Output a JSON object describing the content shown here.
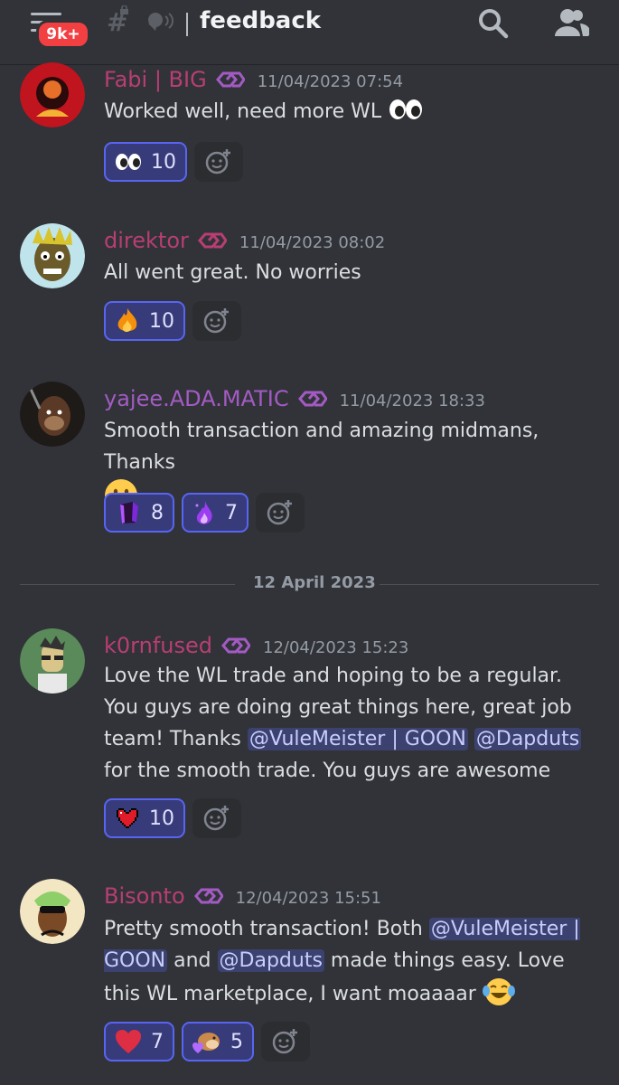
{
  "header": {
    "badge": "9k+",
    "channel_name": "feedback"
  },
  "messages": [
    {
      "username": "Fabi | BIG",
      "timestamp": "11/04/2023 07:54",
      "text": "Worked well, need more WL",
      "reactions": [
        {
          "emoji": "eyes",
          "count": "10"
        }
      ]
    },
    {
      "username": "direktor",
      "timestamp": "11/04/2023 08:02",
      "text": "All went great. No worries",
      "reactions": [
        {
          "emoji": "fire",
          "count": "10"
        }
      ]
    },
    {
      "username": "yajee.ADA.MATIC",
      "timestamp": "11/04/2023 18:33",
      "text": "Smooth transaction and amazing midmans, Thanks",
      "reactions": [
        {
          "emoji": "purple-cube",
          "count": "8"
        },
        {
          "emoji": "purple-flame",
          "count": "7"
        }
      ]
    },
    {
      "username": "k0rnfused",
      "timestamp": "12/04/2023 15:23",
      "text_a": "Love the WL trade and hoping to be a regular. You guys are doing great things here, great job team! Thanks ",
      "mention1": "@VuleMeister | GOON",
      "mention2": "@Dapduts",
      "text_b": " for the smooth trade. You guys are awesome",
      "reactions": [
        {
          "emoji": "pixel-heart",
          "count": "10"
        }
      ]
    },
    {
      "username": "Bisonto",
      "timestamp": "12/04/2023 15:51",
      "text_a": "Pretty smooth transaction! Both ",
      "mention1": "@VuleMeister | GOON",
      "text_mid": " and ",
      "mention2": "@Dapduts",
      "text_b": " made things easy. Love this WL marketplace, I want moaaaar",
      "reactions": [
        {
          "emoji": "red-heart",
          "count": "7"
        },
        {
          "emoji": "hamster-heart",
          "count": "5"
        }
      ]
    }
  ],
  "date_separator": "12 April 2023",
  "colors": {
    "background": "#313338",
    "username_pink": "#b83e74",
    "username_purple": "#a35bc3",
    "reaction_bg": "#383b79",
    "reaction_border": "#5865f2",
    "mention_bg": "#3c4270"
  }
}
